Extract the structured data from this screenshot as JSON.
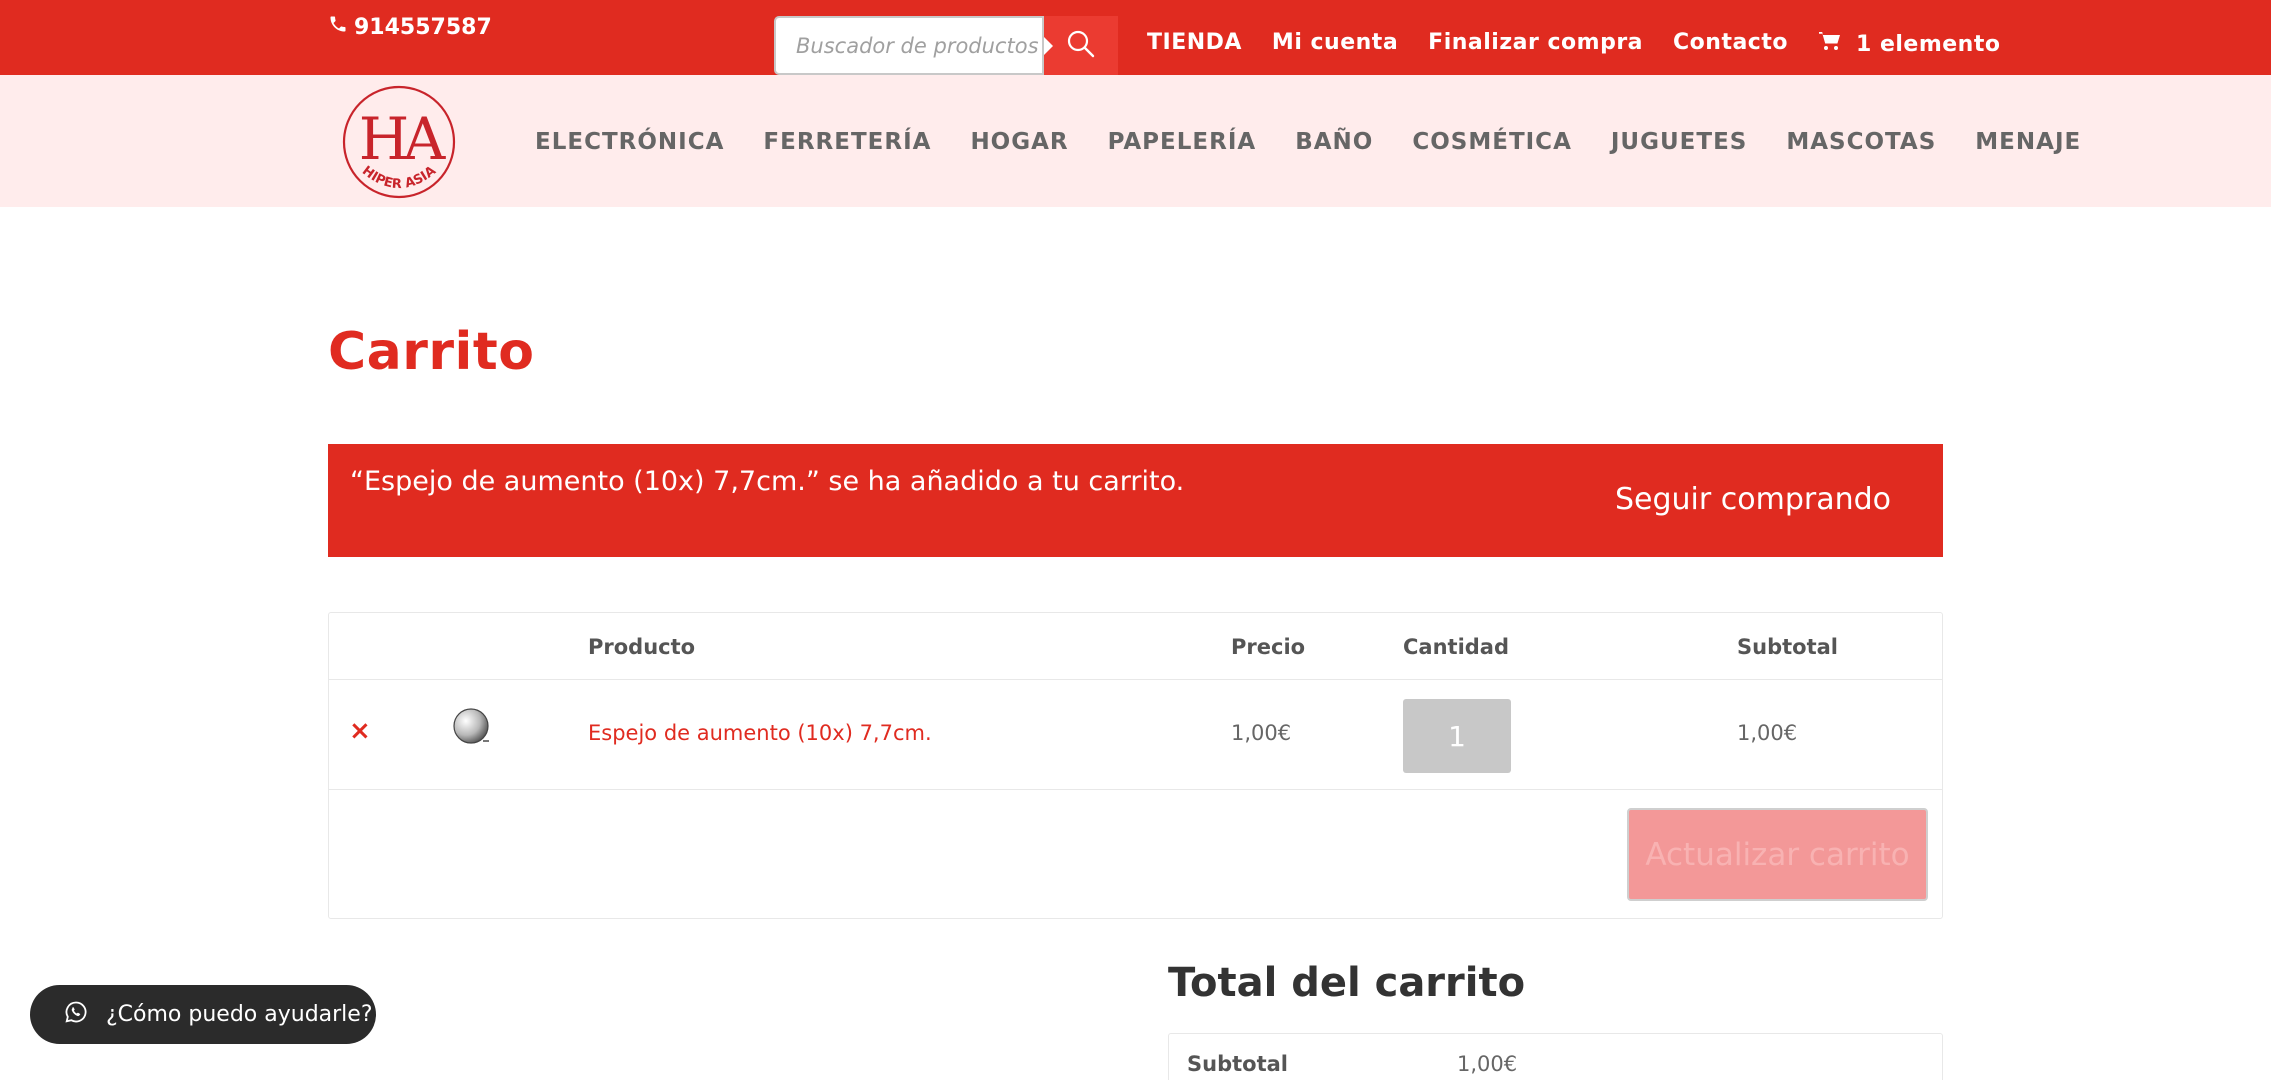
{
  "topbar": {
    "phone": "914557587",
    "search_placeholder": "Buscador de productos",
    "links": [
      {
        "label": "TIENDA"
      },
      {
        "label": "Mi cuenta"
      },
      {
        "label": "Finalizar compra"
      },
      {
        "label": "Contacto"
      }
    ],
    "cart_label": "1 elemento"
  },
  "logo": {
    "monogram": "HA",
    "text": "HIPER ASIA"
  },
  "nav": {
    "items": [
      "ELECTRÓNICA",
      "FERRETERÍA",
      "HOGAR",
      "PAPELERÍA",
      "BAÑO",
      "COSMÉTICA",
      "JUGUETES",
      "MASCOTAS",
      "MENAJE"
    ]
  },
  "page": {
    "title": "Carrito"
  },
  "notice": {
    "message": "“Espejo de aumento (10x) 7,7cm.” se ha añadido a tu carrito.",
    "button": "Seguir comprando"
  },
  "cart": {
    "headers": {
      "product": "Producto",
      "price": "Precio",
      "quantity": "Cantidad",
      "subtotal": "Subtotal"
    },
    "rows": [
      {
        "remove": "×",
        "name": "Espejo de aumento (10x) 7,7cm.",
        "price": "1,00€",
        "quantity": "1",
        "subtotal": "1,00€"
      }
    ],
    "update_button": "Actualizar carrito"
  },
  "totals": {
    "title": "Total del carrito",
    "subtotal_label": "Subtotal",
    "subtotal_value": "1,00€"
  },
  "whatsapp": {
    "label": "¿Cómo puedo ayudarle?"
  },
  "colors": {
    "brand_red": "#e02b20",
    "nav_bg": "#ffecec",
    "update_button": "#f39898",
    "chat_bg": "#2b2b2b"
  }
}
